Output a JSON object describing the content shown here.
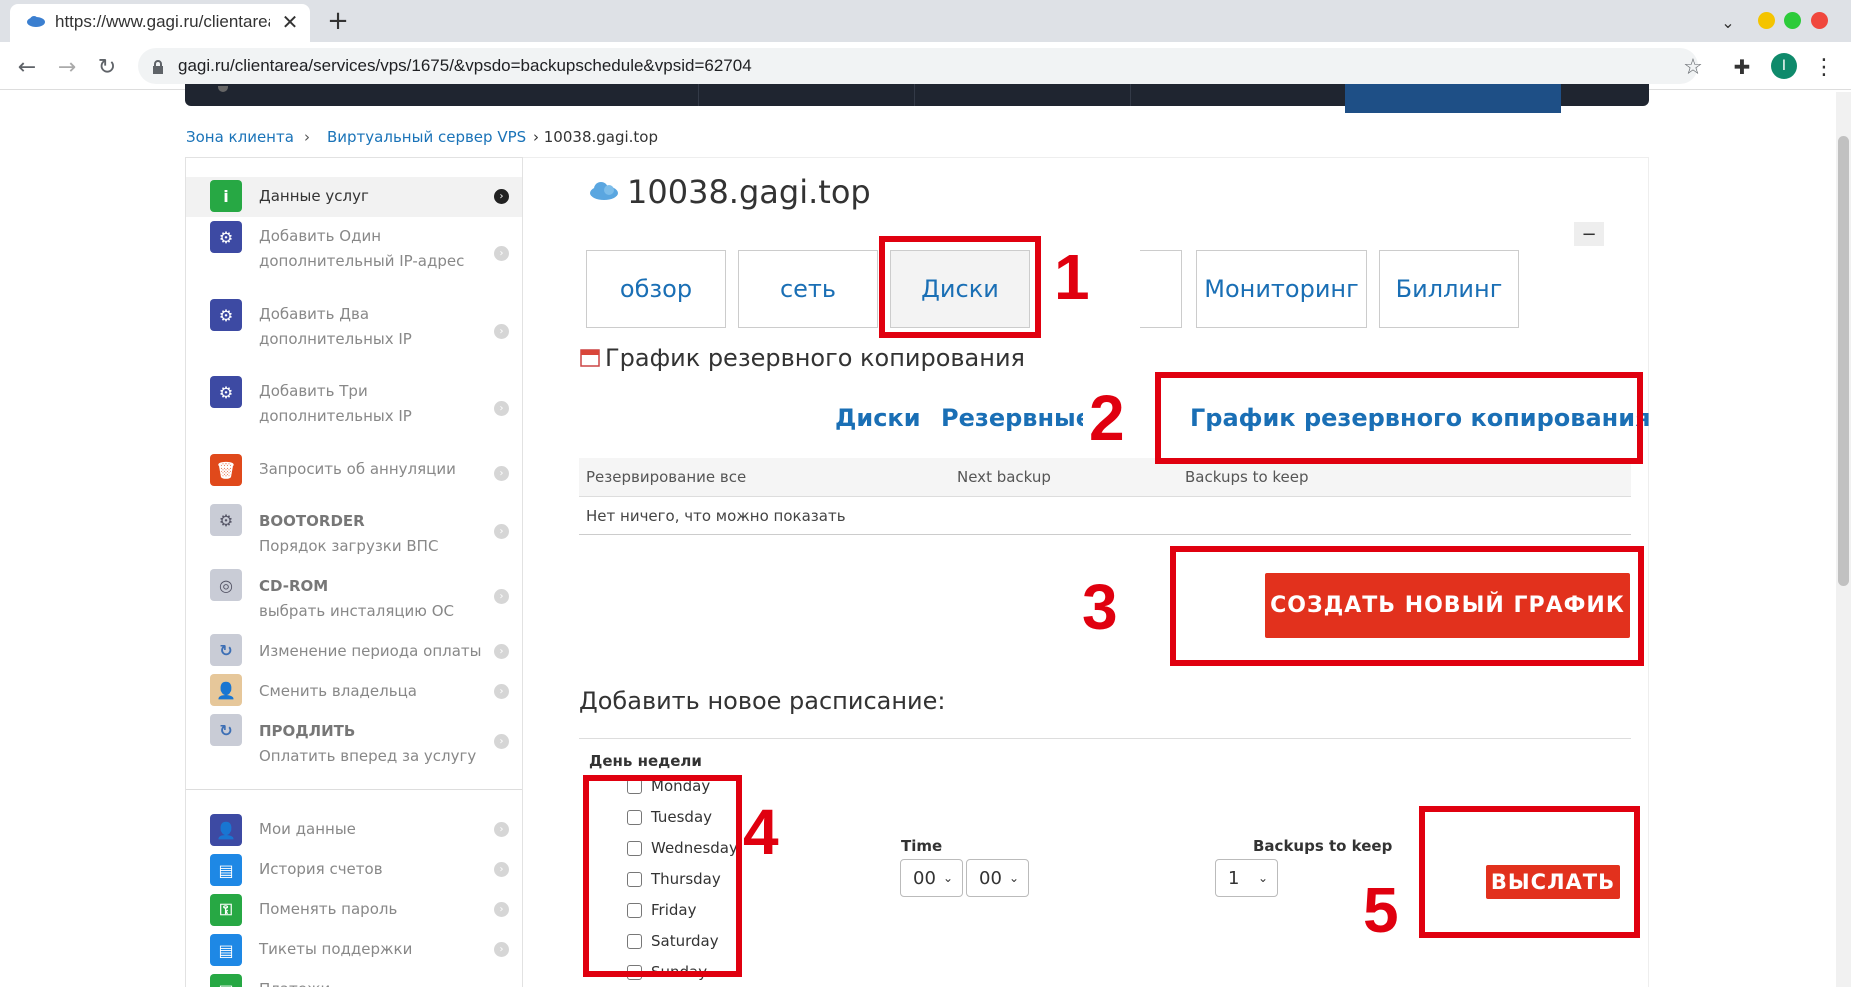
{
  "browser": {
    "tab_title": "https://www.gagi.ru/clientarea",
    "url": "gagi.ru/clientarea/services/vps/1675/&vpsdo=backupschedule&vpsid=62704",
    "profile_initial": "I"
  },
  "breadcrumb": {
    "item1": "Зона клиента",
    "sep": "›",
    "item2": "Виртуальный сервер VPS",
    "item3": "› 10038.gagi.top"
  },
  "sidebar": {
    "items": [
      {
        "label": "Данные услуг"
      },
      {
        "line1": "Добавить Один",
        "line2": "дополнительный IP-адрес"
      },
      {
        "line1": "Добавить Два",
        "line2": "дополнительных IP"
      },
      {
        "line1": "Добавить Три",
        "line2": "дополнительных IP"
      },
      {
        "label": "Запросить об аннуляции"
      },
      {
        "line1": "BOOTORDER",
        "line2": "Порядок загрузки ВПС"
      },
      {
        "line1": "CD-ROM",
        "line2": "выбрать инсталяцию ОС"
      },
      {
        "label": "Изменение периода оплаты"
      },
      {
        "label": "Сменить владельца"
      },
      {
        "line1": "ПРОДЛИТЬ",
        "line2": "Оплатить вперед за услугу"
      },
      {
        "label": "Мои данные"
      },
      {
        "label": "История счетов"
      },
      {
        "label": "Поменять пароль"
      },
      {
        "label": "Тикеты поддержки"
      },
      {
        "label": "Платежи"
      }
    ]
  },
  "main": {
    "server_title": "10038.gagi.top",
    "collapse": "−",
    "tabs": [
      "обзор",
      "сеть",
      "Диски",
      "Мониторинг",
      "Биллинг"
    ],
    "section_title": "График резервного копирования",
    "subtabs": [
      "Диски",
      "Резервные к",
      "График резервного копирования"
    ],
    "table": {
      "headers": [
        "Резервирование все",
        "Next backup",
        "Backups to keep"
      ],
      "empty": "Нет ничего, что можно показать"
    },
    "create_button": "СОЗДАТЬ НОВЫЙ ГРАФИК",
    "add_title": "Добавить новое расписание:",
    "weekday_label": "День недели",
    "days": [
      "Monday",
      "Tuesday",
      "Wednesday",
      "Thursday",
      "Friday",
      "Saturday",
      "Sunday"
    ],
    "time_label": "Time",
    "hour": "00",
    "minute": "00",
    "keep_label": "Backups to keep",
    "keep_value": "1",
    "submit_button": "ВЫСЛАТЬ"
  },
  "annotations": [
    "1",
    "2",
    "3",
    "4",
    "5"
  ],
  "colors": {
    "accent": "#1a6fb5",
    "annotation": "#e0000f",
    "button": "#e2311d"
  }
}
